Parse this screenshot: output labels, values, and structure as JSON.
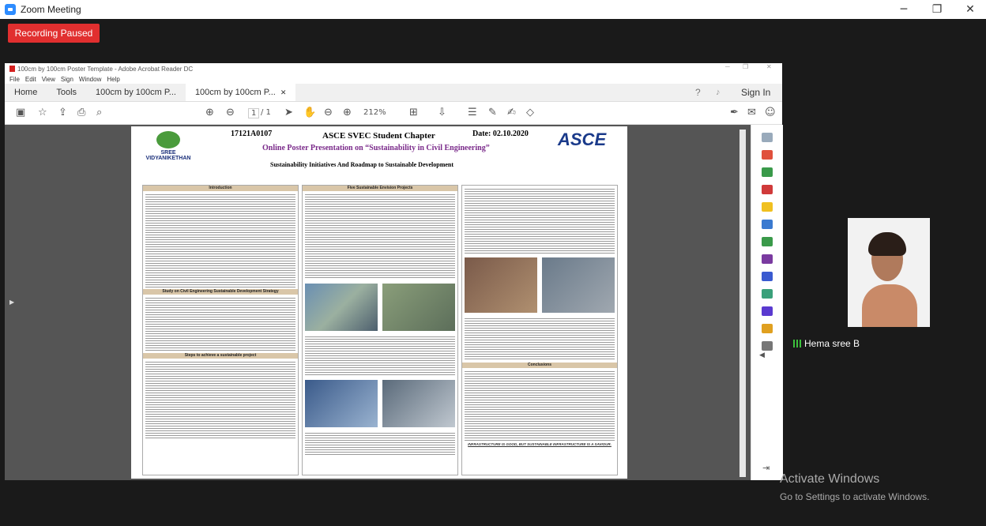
{
  "zoom": {
    "title": "Zoom Meeting",
    "recording_status": "Recording Paused",
    "participant_name": "Hema sree B"
  },
  "acrobat": {
    "window_title": "100cm by 100cm Poster Template - Adobe Acrobat Reader DC",
    "menu": [
      "File",
      "Edit",
      "View",
      "Sign",
      "Window",
      "Help"
    ],
    "tabs": [
      "Home",
      "Tools",
      "100cm by 100cm P...",
      "100cm by 100cm P..."
    ],
    "sign_in": "Sign In",
    "page_current": "1",
    "page_total": "/ 1",
    "zoom_level": "212%"
  },
  "poster": {
    "roll_no": "17121A0107",
    "chapter": "ASCE SVEC Student Chapter",
    "date": "Date: 02.10.2020",
    "presentation": "Online Poster Presentation on “Sustainability in Civil Engineering”",
    "subtitle": "Sustainability Initiatives And Roadmap to Sustainable Development",
    "logo_left": "SREE VIDYANIKETHAN",
    "logo_right": "ASCE",
    "sections": [
      "Introduction",
      "Five Sustainable Envision Projects",
      "Study on Civil Engineering Sustainable Development Strategy",
      "Steps to achieve a sustainable project",
      "Conclusions"
    ],
    "footer": "INFRASTRUCTURE IS GOOD, BUT SUSTAINABLE INFRASTRUCTURE IS A SAVIOUR."
  },
  "watermark": {
    "line1": "Activate Windows",
    "line2": "Go to Settings to activate Windows."
  }
}
